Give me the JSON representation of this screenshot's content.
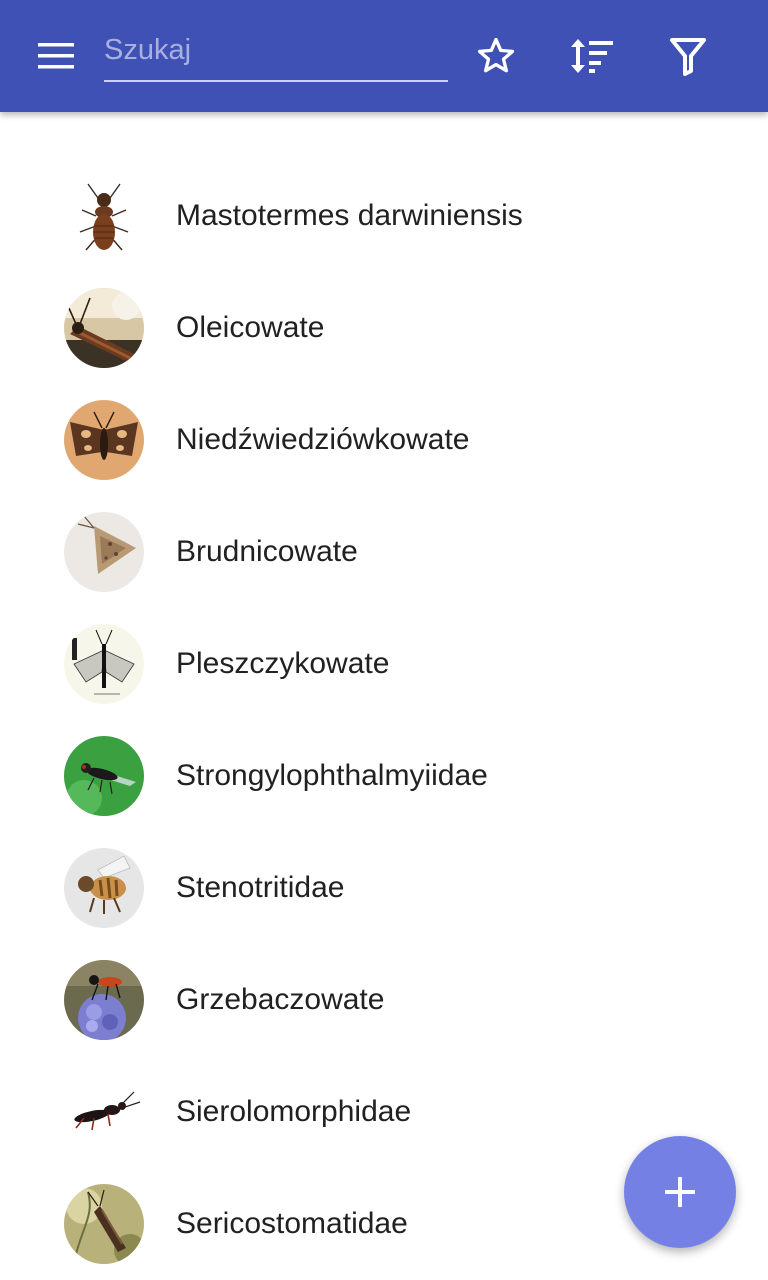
{
  "toolbar": {
    "color": "#3f51b5",
    "menu_icon": "menu-icon",
    "search": {
      "placeholder": "Szukaj",
      "value": ""
    },
    "favorites_icon": "star-outline-icon",
    "sort_icon": "sort-icon",
    "filter_icon": "filter-icon"
  },
  "items": [
    {
      "name": "Mastotermes darwiniensis"
    },
    {
      "name": "Oleicowate"
    },
    {
      "name": "Niedźwiedziówkowate"
    },
    {
      "name": "Brudnicowate"
    },
    {
      "name": "Pleszczykowate"
    },
    {
      "name": "Strongylophthalmyiidae"
    },
    {
      "name": "Stenotritidae"
    },
    {
      "name": "Grzebaczowate"
    },
    {
      "name": "Sierolomorphidae"
    },
    {
      "name": "Sericostomatidae"
    }
  ],
  "fab": {
    "icon": "plus-icon",
    "color": "#7580e4"
  }
}
